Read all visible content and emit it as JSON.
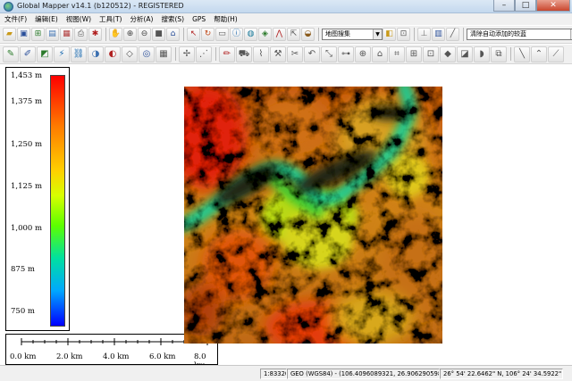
{
  "window": {
    "title": "Global Mapper v14.1 (b120512) - REGISTERED",
    "minimize_label": "–",
    "maximize_label": "□",
    "close_label": "✕"
  },
  "menu": {
    "items": [
      "文件(F)",
      "编辑(E)",
      "视图(W)",
      "工具(T)",
      "分析(A)",
      "搜索(S)",
      "GPS",
      "帮助(H)"
    ]
  },
  "toolbar": {
    "layer_combo_value": "地图搜集",
    "action_combo_value": "清除自动添加的较蓝"
  },
  "legend": {
    "labels": [
      "1,453 m",
      "1,375 m",
      "1,250 m",
      "1,125 m",
      "1,000 m",
      "875 m",
      "750 m"
    ],
    "min_elevation_m": 720,
    "max_elevation_m": 1453
  },
  "scalebar": {
    "labels": [
      "0.0 km",
      "2.0 km",
      "4.0 km",
      "6.0 km",
      "8.0 km"
    ]
  },
  "status": {
    "scale": "1:83320",
    "projection_coords": "GEO (WGS84) - (106.4096089321, 26.9062905981)",
    "dms_coords": "26° 54' 22.6462\" N, 106° 24' 34.5922\" E"
  },
  "colors": {
    "high": "#ff0000",
    "low": "#0000ff",
    "go_button": "#1a9a1a"
  }
}
